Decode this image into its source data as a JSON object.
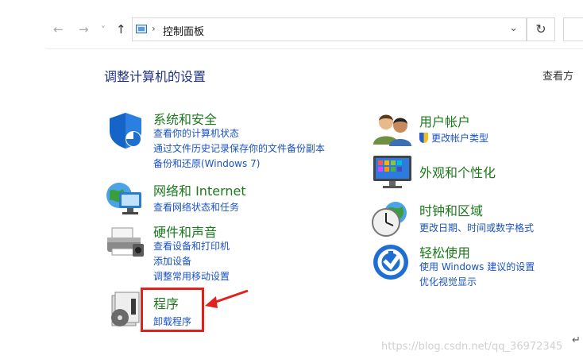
{
  "nav": {
    "back": "←",
    "forward": "→",
    "recent": "˅",
    "up": "↑"
  },
  "address": {
    "separator": "›",
    "crumb": "控制面板",
    "dropdown": "⌄"
  },
  "refresh_glyph": "↻",
  "heading": "调整计算机的设置",
  "view_by": "查看方",
  "left_categories": [
    {
      "title": "系统和安全",
      "icon": "shield-icon",
      "links": [
        "查看你的计算机状态",
        "通过文件历史记录保存你的文件备份副本",
        "备份和还原(Windows 7)"
      ]
    },
    {
      "title": "网络和 Internet",
      "icon": "network-globe-icon",
      "links": [
        "查看网络状态和任务"
      ]
    },
    {
      "title": "硬件和声音",
      "icon": "printer-icon",
      "links": [
        "查看设备和打印机",
        "添加设备",
        "调整常用移动设置"
      ]
    },
    {
      "title": "程序",
      "icon": "programs-disc-icon",
      "links": [
        "卸载程序"
      ]
    }
  ],
  "right_categories": [
    {
      "title": "用户帐户",
      "icon": "users-icon",
      "links": [
        "更改帐户类型"
      ]
    },
    {
      "title": "外观和个性化",
      "icon": "monitor-icon",
      "links": []
    },
    {
      "title": "时钟和区域",
      "icon": "clock-globe-icon",
      "links": [
        "更改日期、时间或数字格式"
      ]
    },
    {
      "title": "轻松使用",
      "icon": "ease-of-access-icon",
      "links": [
        "使用 Windows 建议的设置",
        "优化视觉显示"
      ]
    }
  ],
  "colors": {
    "title_green": "#1c7a1c",
    "link_blue": "#1a52c7",
    "heading_blue": "#1e3287",
    "annotation_red": "#e0221d"
  },
  "watermark": "https://blog.csdn.net/qq_36972345",
  "return_mark": "↵"
}
